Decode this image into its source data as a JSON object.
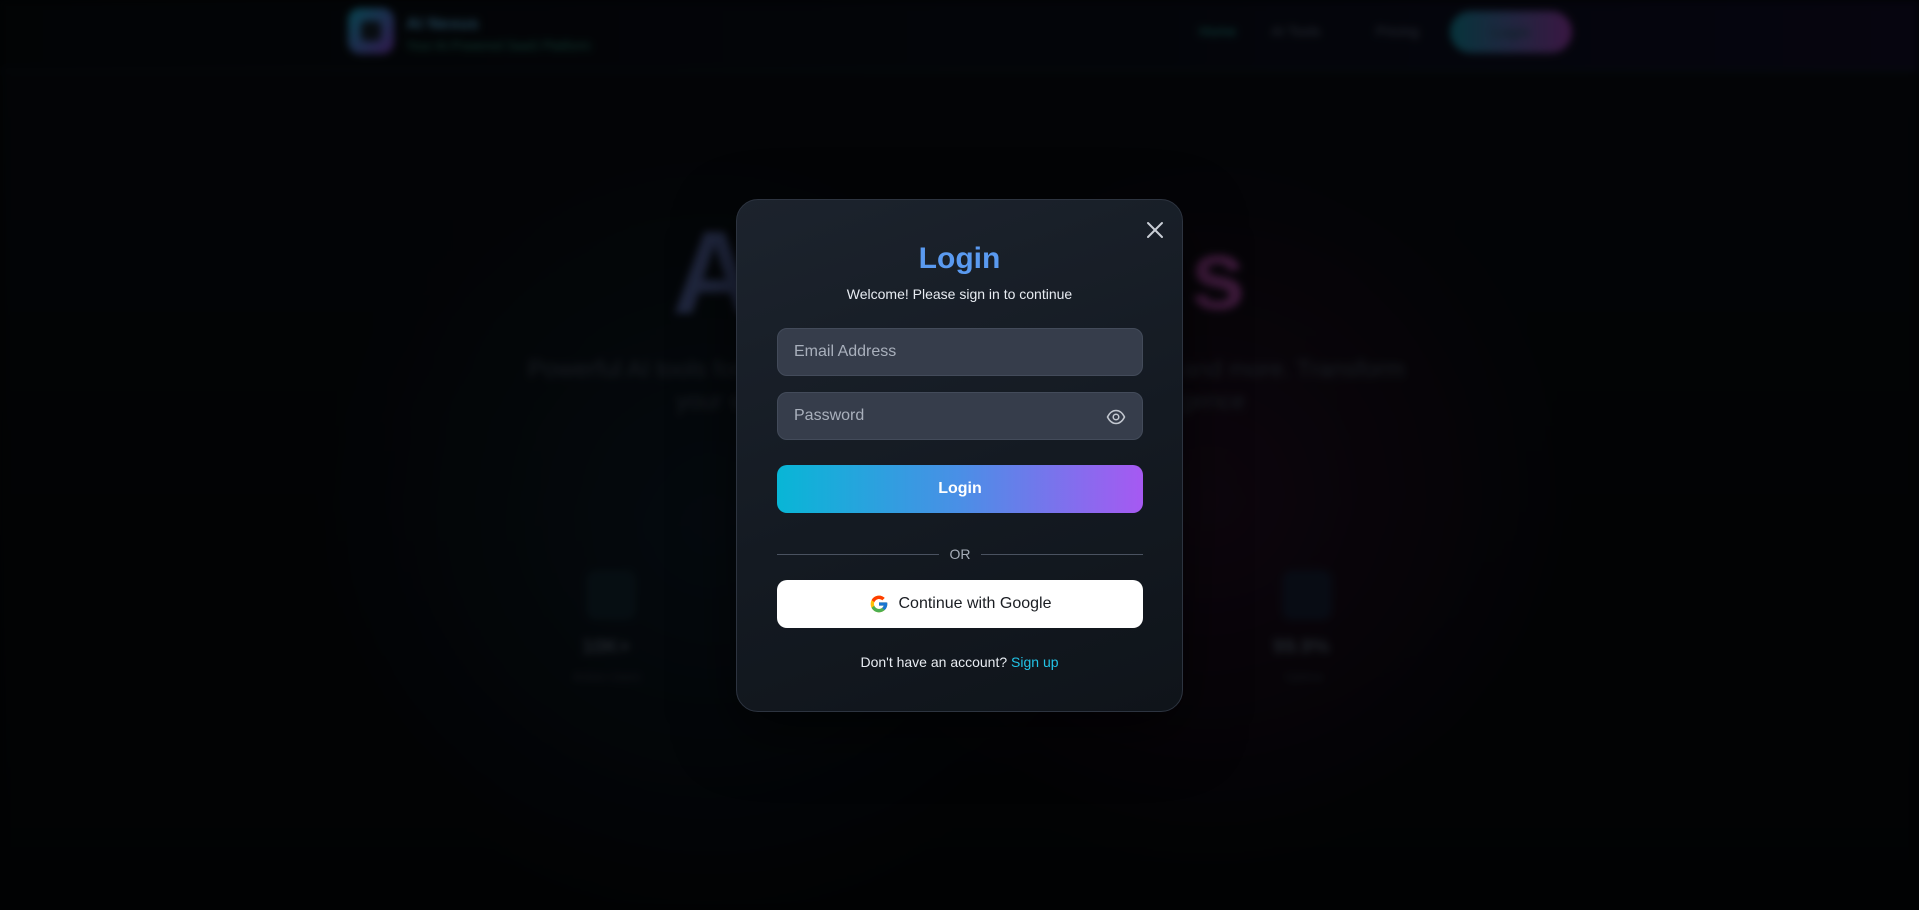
{
  "background": {
    "navbar": {
      "brand_name": "AI Nexus",
      "brand_tagline": "Your AI-Powered SaaS Platform",
      "links": [
        "Home",
        "AI Tools",
        "Pricing"
      ],
      "login_label": "Login"
    },
    "hero": {
      "title_left": "AI",
      "title_right": "s",
      "subtitle_parts": [
        "Powerful AI tools for",
        "and more. Transform",
        "your w",
        "gence"
      ]
    },
    "stats": [
      {
        "value": "10K+",
        "label": "Active Users"
      },
      {
        "value": "99.9%",
        "label": "Uptime"
      }
    ]
  },
  "modal": {
    "title": "Login",
    "subtitle": "Welcome! Please sign in to continue",
    "email_placeholder": "Email Address",
    "password_placeholder": "Password",
    "login_button": "Login",
    "divider_text": "OR",
    "google_button": "Continue with Google",
    "signup_prompt": "Don't have an account?",
    "signup_link": "Sign up"
  },
  "colors": {
    "accent_title": "#5a9af0",
    "login_gradient_start": "#08b6d6",
    "login_gradient_end": "#a659f2",
    "link": "#22c3e6"
  },
  "icons": [
    "close-icon",
    "eye-icon",
    "google-icon"
  ]
}
